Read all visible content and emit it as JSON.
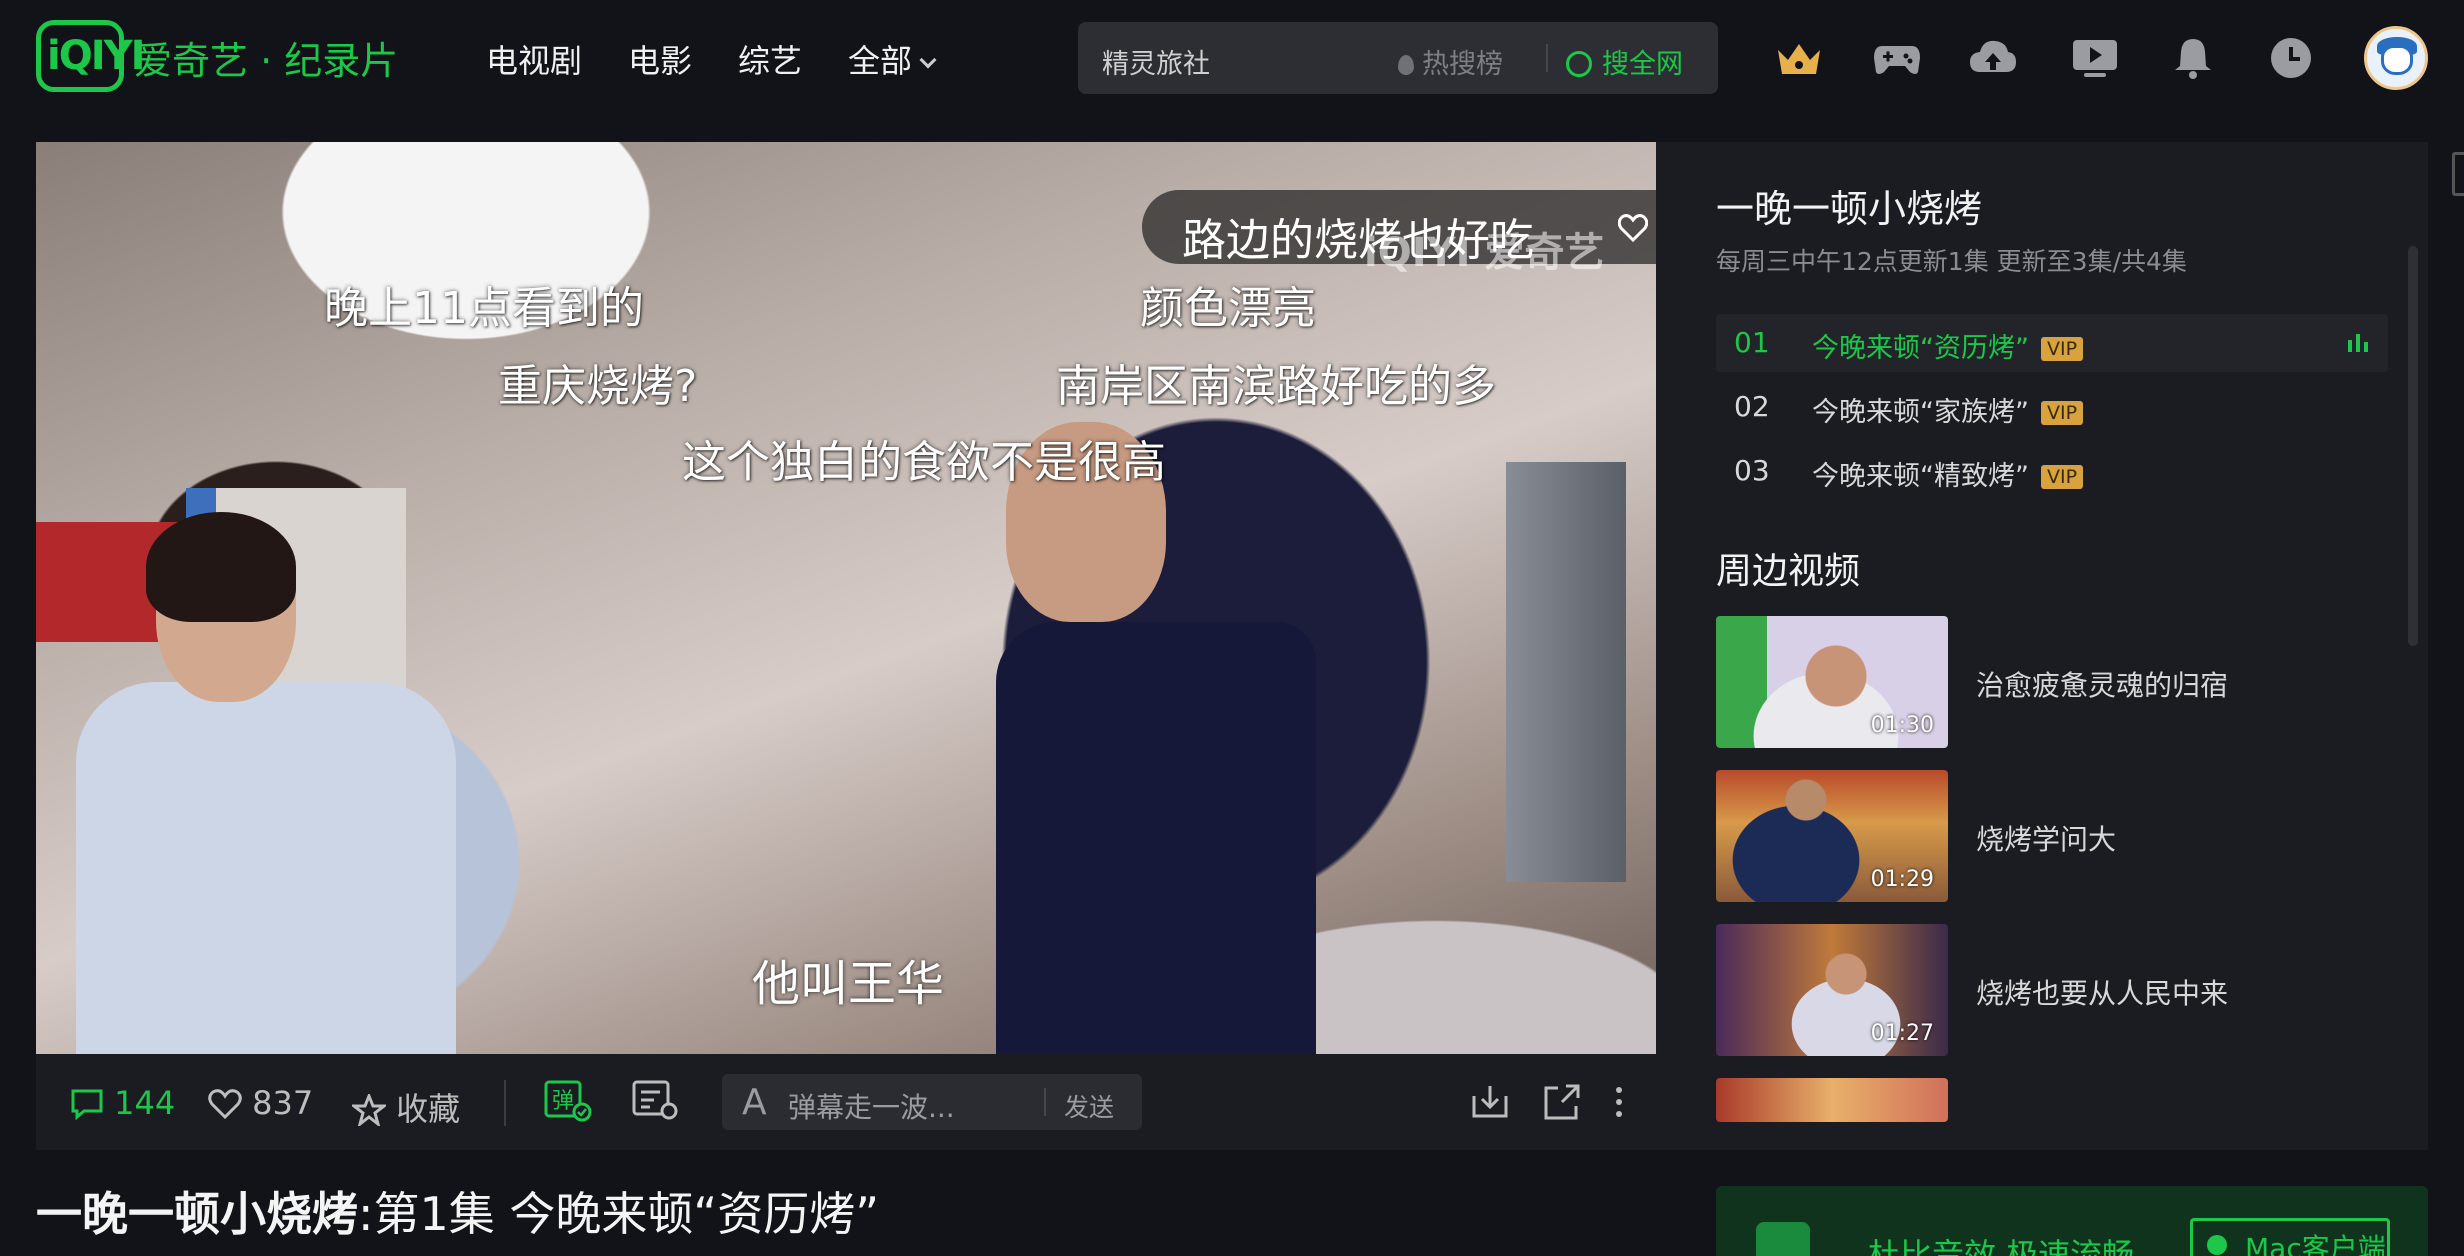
{
  "header": {
    "logo_text": "iQIYI",
    "brand": "爱奇艺 · 纪录片",
    "nav": [
      "电视剧",
      "电影",
      "综艺",
      "全部"
    ],
    "search": {
      "query": "精灵旅社",
      "hot_label": "热搜榜",
      "search_all_label": "搜全网"
    },
    "icons": [
      "vip-crown-icon",
      "gamepad-icon",
      "cloud-upload-icon",
      "video-play-icon",
      "bell-icon",
      "clock-icon"
    ]
  },
  "player": {
    "watermark": "iQIYI 爱奇艺",
    "danmaku": [
      "晚上11点看到的",
      "重庆烧烤?",
      "这个独白的食欲不是很高",
      "颜色漂亮",
      "南岸区南滨路好吃的多"
    ],
    "featured_danmaku": "路边的烧烤也好吃",
    "subtitle": "他叫王华"
  },
  "controls": {
    "comments": "144",
    "likes": "837",
    "favorite": "收藏",
    "danmaku_placeholder": "弹幕走一波...",
    "send": "发送",
    "danmaku_toggle_label": "弹"
  },
  "side": {
    "title": "一晚一顿小烧烤",
    "update_info": "每周三中午12点更新1集 更新至3集/共4集",
    "episodes": [
      {
        "num": "01",
        "name": "今晚来顿“资历烤”",
        "badge": "VIP"
      },
      {
        "num": "02",
        "name": "今晚来顿“家族烤”",
        "badge": "VIP"
      },
      {
        "num": "03",
        "name": "今晚来顿“精致烤”",
        "badge": "VIP"
      }
    ],
    "related_title": "周边视频",
    "clips": [
      {
        "title": "治愈疲惫灵魂的归宿",
        "duration": "01:30"
      },
      {
        "title": "烧烤学问大",
        "duration": "01:29"
      },
      {
        "title": "烧烤也要从人民中来",
        "duration": "01:27"
      }
    ]
  },
  "page": {
    "show_title": "一晚一顿小烧烤",
    "episode_title": "第1集 今晚来顿“资历烤”",
    "separator": ":"
  },
  "promo": {
    "text": "杜比音效 极速流畅",
    "button": "Mac客户端"
  },
  "colors": {
    "accent": "#1cc749",
    "background": "#111319",
    "panel": "#1a1c22",
    "vip": "#d8a33f"
  }
}
